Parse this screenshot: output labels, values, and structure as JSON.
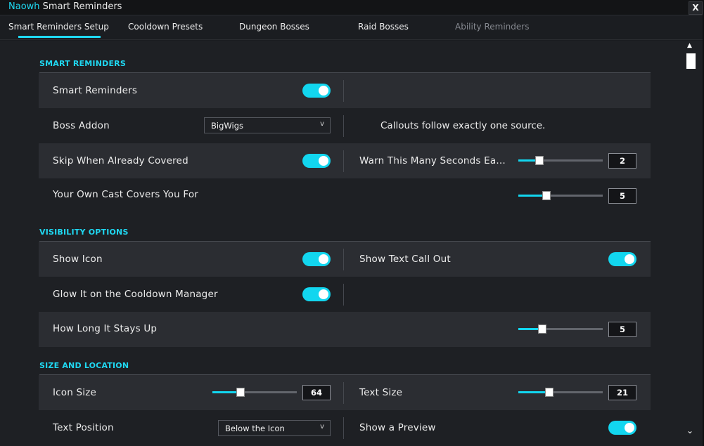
{
  "window": {
    "brand": "Naowh",
    "title_rest": "Smart Reminders",
    "close_label": "X"
  },
  "tabs": [
    {
      "label": "Smart Reminders Setup",
      "active": true
    },
    {
      "label": "Cooldown Presets",
      "active": false
    },
    {
      "label": "Dungeon Bosses",
      "active": false
    },
    {
      "label": "Raid Bosses",
      "active": false
    },
    {
      "label": "Ability Reminders",
      "active": false,
      "disabled": true
    }
  ],
  "colors": {
    "accent": "#1fd8f2",
    "toggle_on": "#12d6ef",
    "row_shaded": "#2b2d32",
    "background": "#1e2024"
  },
  "sections": {
    "smart_reminders": {
      "title": "SMART REMINDERS",
      "smart_reminders_label": "Smart Reminders",
      "smart_reminders_on": true,
      "boss_addon_label": "Boss Addon",
      "boss_addon_value": "BigWigs",
      "boss_addon_note": "Callouts follow exactly one source.",
      "skip_label": "Skip When Already Covered",
      "skip_on": true,
      "warn_label": "Warn This Many Seconds Ea...",
      "warn_value": "2",
      "warn_fraction": 0.25,
      "own_cast_label": "Your Own Cast Covers You For",
      "own_cast_value": "5",
      "own_cast_fraction": 0.33
    },
    "visibility": {
      "title": "VISIBILITY OPTIONS",
      "show_icon_label": "Show Icon",
      "show_icon_on": true,
      "show_text_label": "Show Text Call Out",
      "show_text_on": true,
      "glow_label": "Glow It on the Cooldown Manager",
      "glow_on": true,
      "stays_up_label": "How Long It Stays Up",
      "stays_up_value": "5",
      "stays_up_fraction": 0.28
    },
    "size_location": {
      "title": "SIZE AND LOCATION",
      "icon_size_label": "Icon Size",
      "icon_size_value": "64",
      "icon_size_fraction": 0.33,
      "text_size_label": "Text Size",
      "text_size_value": "21",
      "text_size_fraction": 0.37,
      "text_position_label": "Text Position",
      "text_position_value": "Below the Icon",
      "preview_label": "Show a Preview",
      "preview_on": true
    }
  },
  "icons": {
    "dropdown_chevron": "v",
    "scroll_up": "▲",
    "scroll_down": "⌄"
  }
}
